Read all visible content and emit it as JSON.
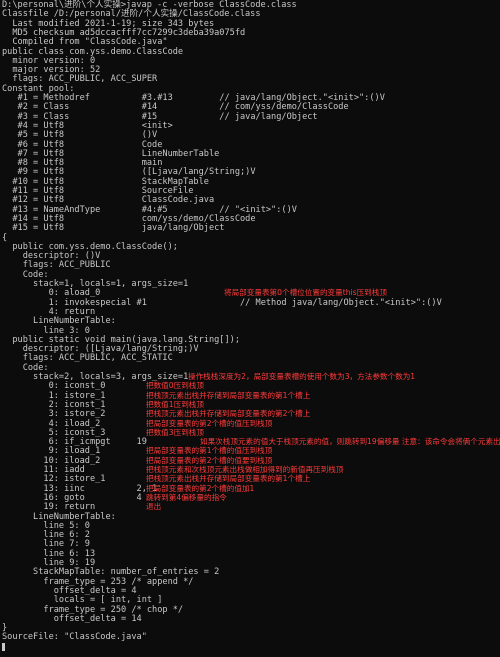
{
  "terminal": {
    "lines": [
      "D:\\personal\\进阶\\个人实操>javap -c -verbose ClassCode.class",
      "Classfile /D:/personal/进阶/个人实操/ClassCode.class",
      "  Last modified 2021-1-19; size 343 bytes",
      "  MD5 checksum ad5dccacfff7cc7299c3deba39a075fd",
      "  Compiled from \"ClassCode.java\"",
      "public class com.yss.demo.ClassCode",
      "  minor version: 0",
      "  major version: 52",
      "  flags: ACC_PUBLIC, ACC_SUPER",
      "Constant pool:",
      "   #1 = Methodref          #3.#13         // java/lang/Object.\"<init>\":()V",
      "   #2 = Class              #14            // com/yss/demo/ClassCode",
      "   #3 = Class              #15            // java/lang/Object",
      "   #4 = Utf8               <init>",
      "   #5 = Utf8               ()V",
      "   #6 = Utf8               Code",
      "   #7 = Utf8               LineNumberTable",
      "   #8 = Utf8               main",
      "   #9 = Utf8               ([Ljava/lang/String;)V",
      "  #10 = Utf8               StackMapTable",
      "  #11 = Utf8               SourceFile",
      "  #12 = Utf8               ClassCode.java",
      "  #13 = NameAndType        #4:#5          // \"<init>\":()V",
      "  #14 = Utf8               com/yss/demo/ClassCode",
      "  #15 = Utf8               java/lang/Object",
      "{",
      "  public com.yss.demo.ClassCode();",
      "    descriptor: ()V",
      "    flags: ACC_PUBLIC",
      "    Code:",
      "      stack=1, locals=1, args_size=1",
      "         0: aload_0",
      "         1: invokespecial #1                  // Method java/lang/Object.\"<init>\":()V",
      "         4: return",
      "      LineNumberTable:",
      "        line 3: 0",
      "  public static void main(java.lang.String[]);",
      "    descriptor: ([Ljava/lang/String;)V",
      "    flags: ACC_PUBLIC, ACC_STATIC",
      "    Code:",
      "      stack=2, locals=3, args_size=1",
      "         0: iconst_0",
      "         1: istore_1",
      "         2: iconst_1",
      "         3: istore_2",
      "         4: iload_2",
      "         5: iconst_3",
      "         6: if_icmpgt     19",
      "         9: iload_1",
      "        10: iload_2",
      "        11: iadd",
      "        12: istore_1",
      "        13: iinc          2, 1",
      "        16: goto          4",
      "        19: return",
      "      LineNumberTable:",
      "        line 5: 0",
      "        line 6: 2",
      "        line 7: 9",
      "        line 6: 13",
      "        line 9: 19",
      "      StackMapTable: number_of_entries = 2",
      "        frame_type = 253 /* append */",
      "          offset_delta = 4",
      "          locals = [ int, int ]",
      "        frame_type = 250 /* chop */",
      "          offset_delta = 14",
      "}",
      "SourceFile: \"ClassCode.java\""
    ],
    "notes": [
      {
        "line": 31,
        "text": "将局部变量表第0个槽位位置的变量this压到栈顶"
      },
      {
        "line": 40,
        "text": "操作栈栈深度为2，局部变量表槽的使用个数为3，方法参数个数为1"
      },
      {
        "line": 41,
        "text": "把数值0压到栈顶"
      },
      {
        "line": 42,
        "text": "把栈顶元素出栈并存储到局部变量表的第1个槽上"
      },
      {
        "line": 43,
        "text": "把数值1压到栈顶"
      },
      {
        "line": 44,
        "text": "把栈顶元素出栈并存储到局部变量表的第2个槽上"
      },
      {
        "line": 45,
        "text": "把局部变量表的第2个槽的值压到栈顶"
      },
      {
        "line": 46,
        "text": "把数值3压到栈顶"
      },
      {
        "line": 47,
        "text": "如果次栈顶元素的值大于栈顶元素的值，则跳转到19偏移量 注意：该命令会将俩个元素出栈"
      },
      {
        "line": 48,
        "text": "把局部变量表的第1个槽的值压到栈顶"
      },
      {
        "line": 49,
        "text": "把局部变量表的第2个槽的值要到栈顶"
      },
      {
        "line": 50,
        "text": "把栈顶元素和次栈顶元素出栈做相加得到的新值再压到栈顶"
      },
      {
        "line": 51,
        "text": "把栈顶元素出栈并存储到局部变量表的第1个槽上"
      },
      {
        "line": 52,
        "text": "把局部变量表的第2个槽的值加1"
      },
      {
        "line": 53,
        "text": "跳转到第4偏移量的指令"
      },
      {
        "line": 54,
        "text": "退出"
      }
    ]
  }
}
